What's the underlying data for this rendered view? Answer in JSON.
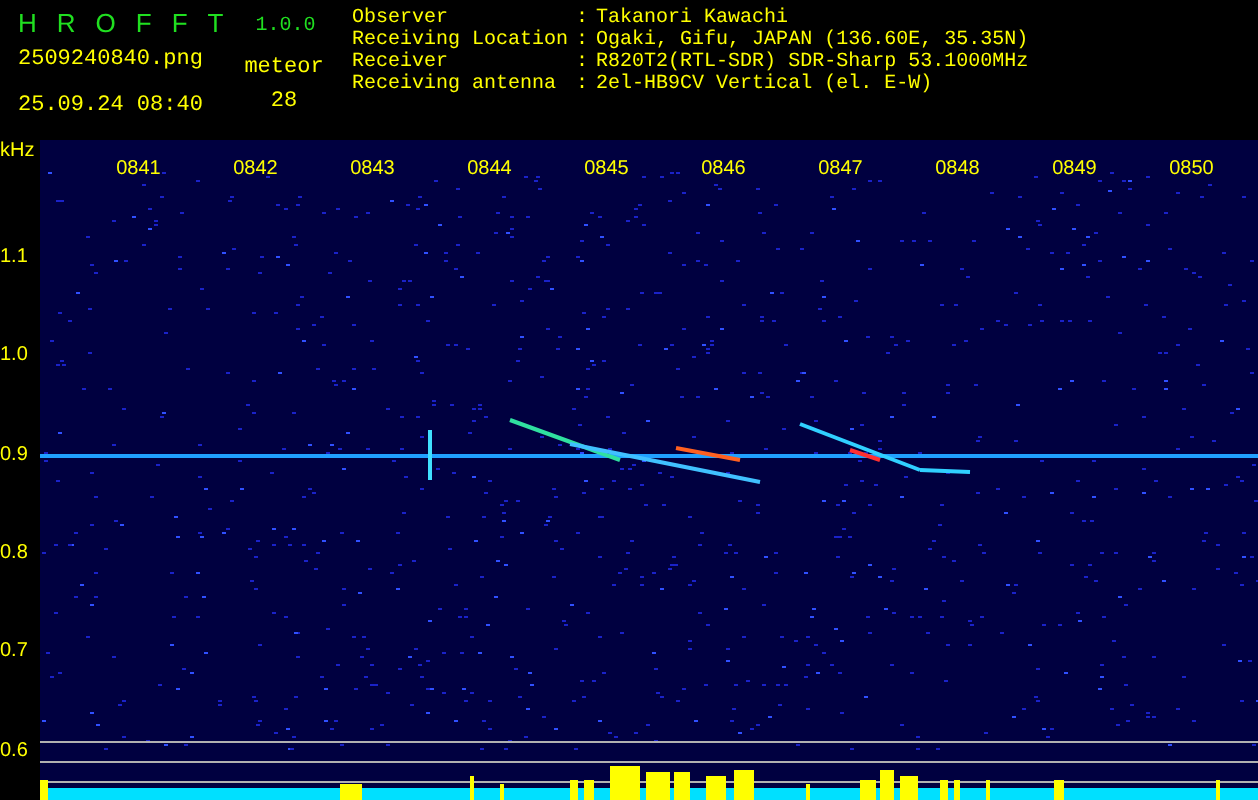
{
  "app": {
    "name": "HROFFT",
    "version": "1.0.0"
  },
  "file": {
    "name": "2509240840.png",
    "datetime": "25.09.24 08:40"
  },
  "count": {
    "label": "meteor",
    "value": "28"
  },
  "info": [
    {
      "label": "Observer",
      "separator": ":",
      "value": "Takanori Kawachi"
    },
    {
      "label": "Receiving Location",
      "separator": ":",
      "value": "Ogaki, Gifu, JAPAN (136.60E, 35.35N)"
    },
    {
      "label": "Receiver",
      "separator": ":",
      "value": "R820T2(RTL-SDR) SDR-Sharp 53.1000MHz"
    },
    {
      "label": "Receiving antenna",
      "separator": ":",
      "value": "2el-HB9CV Vertical (el. E-W)"
    }
  ],
  "y_axis": {
    "unit": "kHz",
    "labels": [
      "1.1",
      "1.0",
      "0.9",
      "0.8",
      "0.7",
      "0.6"
    ]
  },
  "time_labels": [
    "0841",
    "0842",
    "0843",
    "0844",
    "0845",
    "0846",
    "0847",
    "0848",
    "0849",
    "0850"
  ]
}
